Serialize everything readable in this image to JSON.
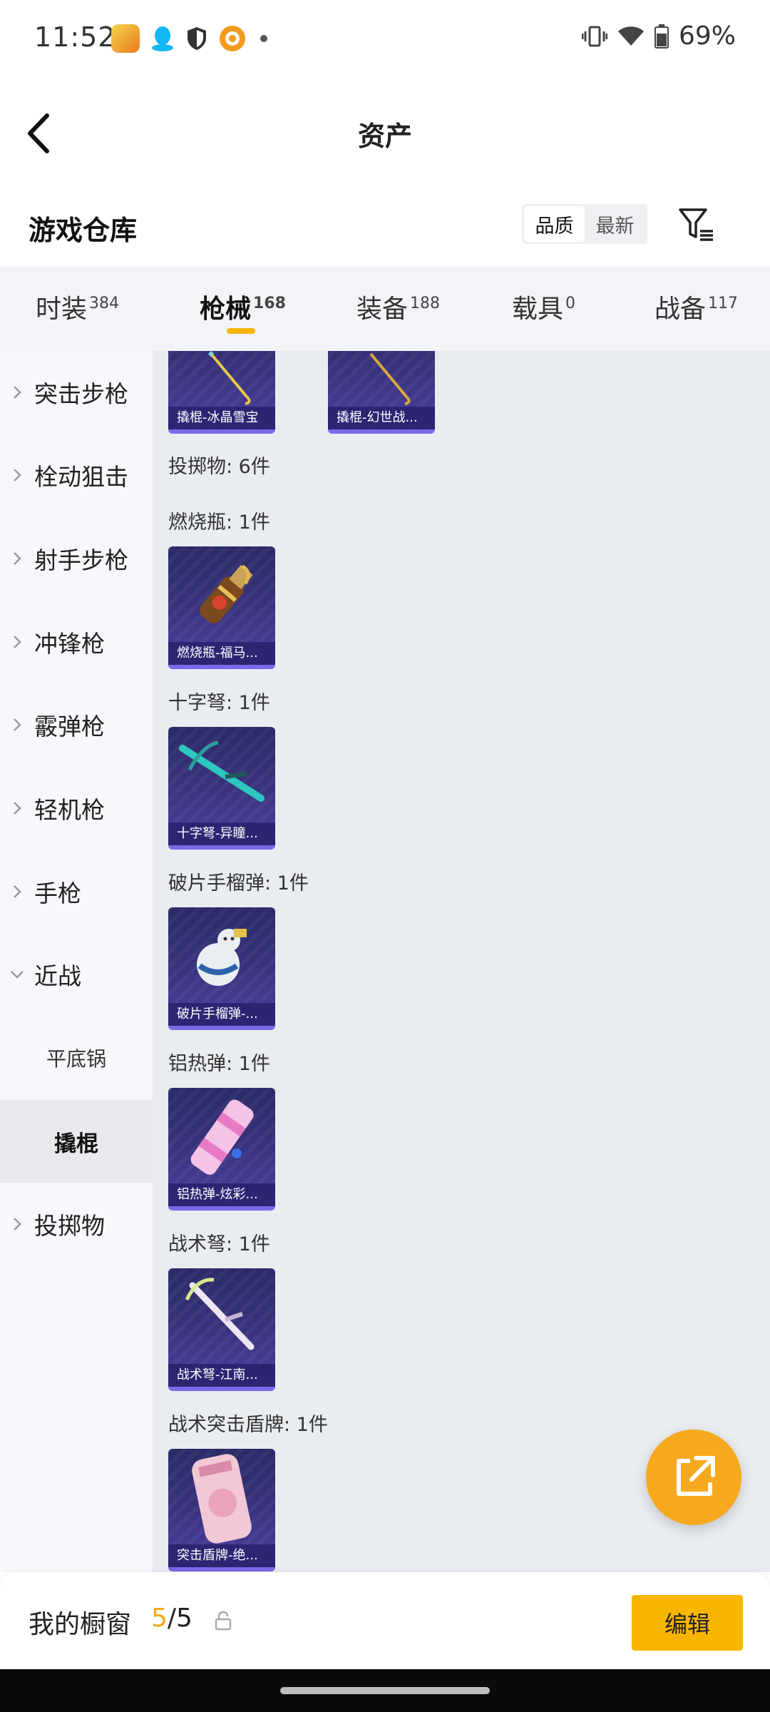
{
  "status_bar": {
    "time": "11:52",
    "battery": "69%"
  },
  "header": {
    "title": "资产"
  },
  "sub_header": {
    "title": "游戏仓库",
    "sort_options": [
      "品质",
      "最新"
    ]
  },
  "tabs": [
    {
      "label": "时装",
      "count": "384"
    },
    {
      "label": "枪械",
      "count": "168"
    },
    {
      "label": "装备",
      "count": "188"
    },
    {
      "label": "载具",
      "count": "0"
    },
    {
      "label": "战备",
      "count": "117"
    }
  ],
  "sidebar": {
    "items": [
      {
        "label": "突击步枪"
      },
      {
        "label": "栓动狙击"
      },
      {
        "label": "射手步枪"
      },
      {
        "label": "冲锋枪"
      },
      {
        "label": "霰弹枪"
      },
      {
        "label": "轻机枪"
      },
      {
        "label": "手枪"
      },
      {
        "label": "近战"
      },
      {
        "label": "投掷物"
      }
    ],
    "sub_items": [
      {
        "label": "平底锅"
      },
      {
        "label": "撬棍"
      }
    ]
  },
  "content": {
    "top_cards": [
      "撬棍-冰晶雪宝",
      "撬棍-幻世战..."
    ],
    "section_title": "投掷物: 6件",
    "groups": [
      {
        "label": "燃烧瓶: 1件",
        "card": "燃烧瓶-福马..."
      },
      {
        "label": "十字弩: 1件",
        "card": "十字弩-异瞳..."
      },
      {
        "label": "破片手榴弹: 1件",
        "card": "破片手榴弹-..."
      },
      {
        "label": "铝热弹: 1件",
        "card": "铝热弹-炫彩..."
      },
      {
        "label": "战术弩: 1件",
        "card": "战术弩-江南..."
      },
      {
        "label": "战术突击盾牌: 1件",
        "card": "突击盾牌-绝..."
      }
    ]
  },
  "bottom_bar": {
    "label": "我的橱窗",
    "count_current": "5",
    "count_total": "/5",
    "edit_label": "编辑"
  },
  "colors": {
    "accent": "#f7b500",
    "fab": "#f6a91c",
    "card_bg": "#3a3480"
  }
}
